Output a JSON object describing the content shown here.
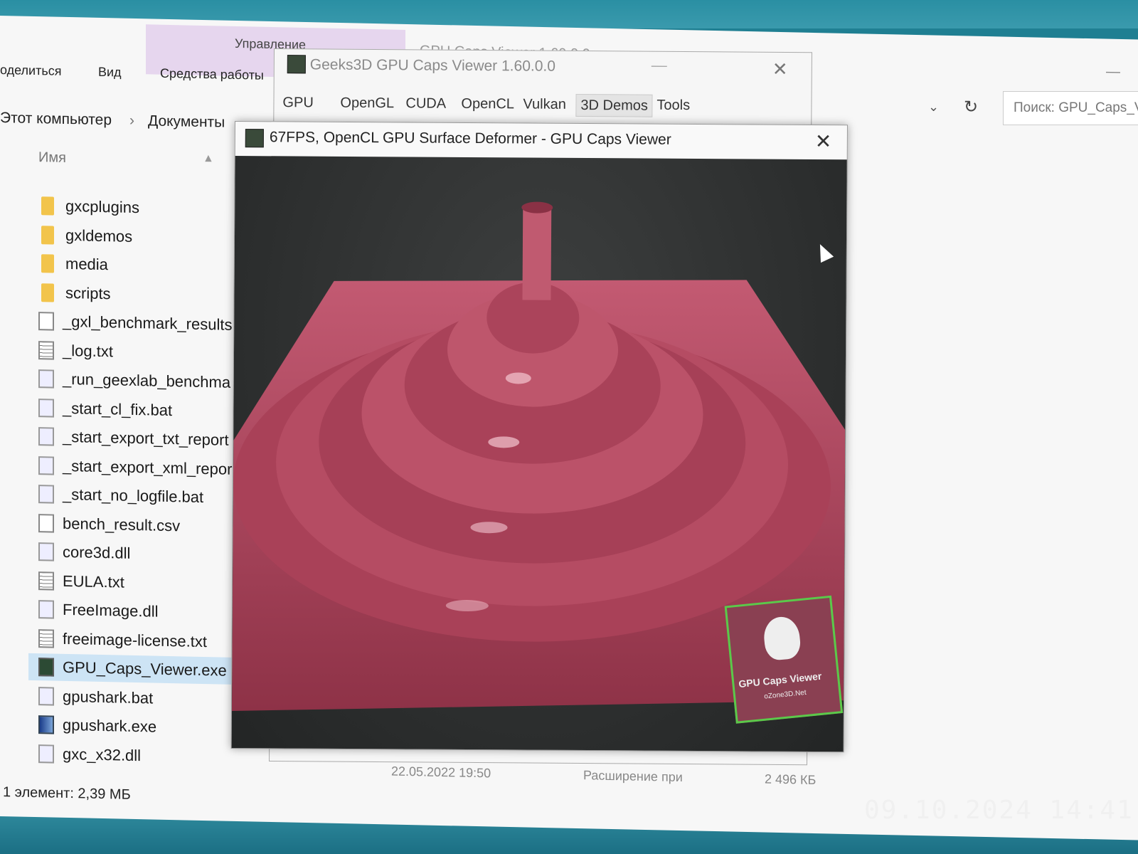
{
  "explorer": {
    "window_title": "GPU Caps Viewer 1.60.0.0",
    "ribbon_context": "Управление",
    "ribbon_tabs": [
      "оделиться",
      "Вид",
      "Средства работы"
    ],
    "breadcrumb": [
      "Этот компьютер",
      "Документы"
    ],
    "search_placeholder": "Поиск: GPU_Caps_V",
    "column_name": "Имя",
    "files": [
      {
        "name": "gxcplugins",
        "icon": "folder-icon"
      },
      {
        "name": "gxldemos",
        "icon": "folder-icon"
      },
      {
        "name": "media",
        "icon": "folder-icon"
      },
      {
        "name": "scripts",
        "icon": "folder-icon"
      },
      {
        "name": "_gxl_benchmark_results",
        "icon": "file-icon"
      },
      {
        "name": "_log.txt",
        "icon": "text-file-icon"
      },
      {
        "name": "_run_geexlab_benchma",
        "icon": "batch-file-icon"
      },
      {
        "name": "_start_cl_fix.bat",
        "icon": "batch-file-icon"
      },
      {
        "name": "_start_export_txt_report",
        "icon": "batch-file-icon"
      },
      {
        "name": "_start_export_xml_repor",
        "icon": "batch-file-icon"
      },
      {
        "name": "_start_no_logfile.bat",
        "icon": "batch-file-icon"
      },
      {
        "name": "bench_result.csv",
        "icon": "file-icon"
      },
      {
        "name": "core3d.dll",
        "icon": "dll-file-icon"
      },
      {
        "name": "EULA.txt",
        "icon": "text-file-icon"
      },
      {
        "name": "FreeImage.dll",
        "icon": "dll-file-icon"
      },
      {
        "name": "freeimage-license.txt",
        "icon": "text-file-icon"
      },
      {
        "name": "GPU_Caps_Viewer.exe",
        "icon": "gpu-caps-exe-icon",
        "selected": true
      },
      {
        "name": "gpushark.bat",
        "icon": "batch-file-icon"
      },
      {
        "name": "gpushark.exe",
        "icon": "gpushark-exe-icon"
      },
      {
        "name": "gxc_x32.dll",
        "icon": "dll-file-icon"
      }
    ],
    "status": "1 элемент: 2,39 МБ",
    "detail_ghost": {
      "date": "22.05.2022 19:50",
      "type": "Расширение при",
      "size": "2 496 КБ"
    }
  },
  "gcv": {
    "title": "Geeks3D GPU Caps Viewer 1.60.0.0",
    "tabs": [
      "GPU",
      "OpenGL",
      "CUDA",
      "OpenCL",
      "Vulkan",
      "3D Demos",
      "Tools"
    ],
    "active_tab": "3D Demos"
  },
  "demo": {
    "title": "67FPS, OpenCL GPU Surface Deformer - GPU Caps Viewer",
    "surface_color": "#b0485f",
    "background_color": "#2e3030",
    "logo_text": "GPU Caps Viewer",
    "logo_sub": "oZone3D.Net"
  },
  "overlay": {
    "timestamp": "09.10.2024 14:41"
  }
}
